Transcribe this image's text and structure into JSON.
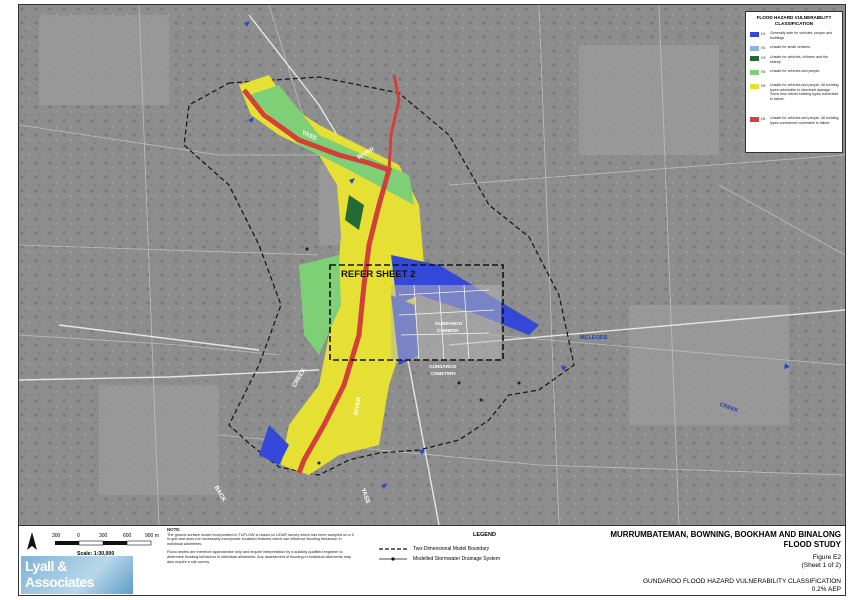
{
  "legend": {
    "title": "FLOOD HAZARD VULNERABILITY CLASSIFICATION",
    "items": [
      {
        "code": "H1",
        "color": "#3348d8",
        "text": "Generally safe for vehicles, people and buildings"
      },
      {
        "code": "H2",
        "color": "#8fb2df",
        "text": "Unsafe for small vehicles."
      },
      {
        "code": "H3",
        "color": "#236b35",
        "text": "Unsafe for vehicles, children and the elderly."
      },
      {
        "code": "H4",
        "color": "#7fcf77",
        "text": "Unsafe for vehicles and people."
      },
      {
        "code": "H5",
        "color": "#e6e034",
        "text": "Unsafe for vehicles and people. All building types vulnerable to structural damage. Some less robust building types vulnerable to failure."
      },
      {
        "code": "H6",
        "color": "#d2403a",
        "text": "Unsafe for vehicles and people. All building types considered vulnerable to failure."
      }
    ]
  },
  "map_labels": {
    "refer": "REFER SHEET 2",
    "yass_river_1": "YASS",
    "yass_river_2": "RIVER",
    "gundaroo_common_1": "GUNDAROO",
    "gundaroo_common_2": "COMMON",
    "gundaroo_cemetery_1": "GUNDAROO",
    "gundaroo_cemetery_2": "CEMETERY",
    "mcleods": "MCLEODS",
    "creek_east": "CREEK",
    "creek_west": "CREEK",
    "river_south": "RIVER",
    "yass_south": "YASS",
    "back": "BACK"
  },
  "scale": {
    "ticks": [
      "300",
      "0",
      "300",
      "600",
      "900 m"
    ],
    "label": "Scale: 1:30,000"
  },
  "notes": {
    "heading": "NOTE:",
    "p1": "The ground surface model incorporated in TUFLOW is based on LiDAR survey which has been sampled on a 5 m grid and does not necessarily incorporate localised features which can influence flooding behaviour in individual allotments.",
    "p2": "Flood depths are therefore approximate only and require interpretation by a suitably qualified engineer to determine flooding behaviour in individual allotments. Any assessment of flooding in individual allotments may also require a site survey."
  },
  "bottom_legend": {
    "title": "LEGEND",
    "boundary": "Two-Dimensional Model Boundary",
    "drainage": "Modelled Stormwater Drainage System"
  },
  "logo": {
    "line1": "Lyall &",
    "line2": "Associates"
  },
  "title_block": {
    "line1": "MURRUMBATEMAN, BOWNING, BOOKHAM AND BINALONG",
    "line2": "FLOOD STUDY",
    "figure": "Figure E2",
    "sheet": "(Sheet 1 of 2)",
    "line5": "GUNDAROO FLOOD HAZARD VULNERABILITY CLASSIFICATION",
    "aep": "0.2% AEP"
  },
  "north_arrow": "N"
}
